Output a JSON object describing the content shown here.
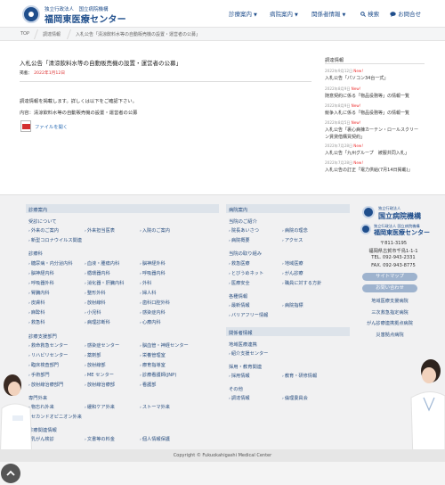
{
  "header": {
    "logo_sub": "独立行政法人　国立病院機構",
    "logo_title": "福岡東医療センター",
    "nav": {
      "item1": "診療案内",
      "item2": "病院案内",
      "item3": "関係者情報",
      "item4": "検索",
      "item5": "お問合せ"
    }
  },
  "breadcrumb": {
    "home": "TOP",
    "parent": "調達情報",
    "current": "入札公告「清涼飲料水等の自動販売機の設置・運営者の公募」"
  },
  "article": {
    "title": "入札公告「清涼飲料水等の自動販売機の設置・運営者の公募」",
    "date_label": "掲載：",
    "date_value": "2022年1月12日",
    "paragraph1": "調達情報を掲載します。詳しくは以下をご確認下さい。",
    "paragraph2": "内容：清涼飲料水等の自動販売機の設置・運営者の公募",
    "file_link": "ファイルを開く"
  },
  "sidebar": {
    "title": "調達情報",
    "new_badge": "New!",
    "entries": {
      "e1": {
        "date": "2022年9月12日",
        "text": "入札公告「パソコン34台一式」"
      },
      "e2": {
        "date": "2022年8月9日",
        "text": "随意契約に係る「物品役務等」の情報一覧"
      },
      "e3": {
        "date": "2022年8月9日",
        "text": "競争入札に係る「物品役務等」の情報一覧"
      },
      "e4": {
        "date": "2022年8月5日",
        "text1": "入札公告「裏心病棟カーテン・ロールスクリー",
        "text2": "ン賃貸借購買契約」"
      },
      "e5": {
        "date": "2022年7月28日",
        "text": "入札公告「九州グループ　被服共同入札」"
      },
      "e6": {
        "date": "2022年7月28日",
        "text": "入札公告の訂正「電力供給(7月14日掲載)」"
      }
    }
  },
  "footer": {
    "heads": {
      "shinryo": "診療案内",
      "byoin": "病院案内",
      "kankei": "関係者情報"
    },
    "sub": {
      "gairai_head": "受診について",
      "shinryoka_head": "診療科",
      "support_head": "診療支援部門",
      "senmon_head": "専門外来",
      "sonota_head": "診療関連情報",
      "intro_head": "当院のご紹介",
      "torikumi_head": "当院の取り組み",
      "kaku_head": "各種情報",
      "renkei_head": "地域医療連携",
      "saiyo_head": "採用・教育関連",
      "other_head": "その他"
    },
    "links": {
      "jushin": [
        "外来のご案内",
        "新型コロナウイルス関連",
        "外来担当医表",
        "入院のご案内"
      ],
      "shinryoka": [
        "糖尿病・内分泌内科",
        "脳神経内科",
        "呼吸器外科",
        "腎臓内科",
        "皮膚科",
        "麻酔科",
        "救急科",
        "血液・腫瘍内科",
        "循環器内科",
        "消化器・肝臓内科",
        "整形外科",
        "放射線科",
        "小児科",
        "病理診断科",
        "脳神経外科",
        "呼吸器内科",
        "外科",
        "婦人科",
        "歯科口腔外科",
        "感染症内科",
        "心療内科"
      ],
      "support": [
        "救命救急センター",
        "リハビリセンター",
        "臨床検査部門",
        "手術部門",
        "放射線治療部門",
        "感染症センター",
        "薬剤部",
        "放射線部",
        "ME センター",
        "放射線治療部",
        "脳血管・神経センター",
        "栄養管理室",
        "療育指導室",
        "診療看護師(JNP)",
        "看護部"
      ],
      "senmon": [
        "物忘れ外来",
        "セカンドオピニオン外来",
        "緩和ケア外来",
        "ストーマ外来"
      ],
      "sonota": [
        "乳がん検診",
        "文書等の料金",
        "個人情報保護"
      ],
      "intro": [
        "院長あいさつ",
        "病院概要",
        "病院の理念",
        "アクセス"
      ],
      "torikumi": [
        "救急医療",
        "とびうめネット",
        "医療安全",
        "地域医療",
        "がん診療",
        "職員に対する方針"
      ],
      "kaku": [
        "最新情報",
        "バリアフリー情報",
        "病院指標"
      ],
      "renkei": [
        "紹介支援センター"
      ],
      "saiyo": [
        "採用情報",
        "教育・研修情報"
      ],
      "other": [
        "調達情報",
        "倫理委員会"
      ]
    },
    "logo1_sub": "独立行政法人",
    "logo1_title": "国立病院機構",
    "logo2_sub": "独立行政法人 国立病院機構",
    "logo2_title": "福岡東医療センター",
    "postal": "〒811-3195",
    "address": "福岡県古賀市千鳥1-1-1",
    "tel": "TEL. 092-943-2331",
    "fax": "FAX. 092-943-8775",
    "btn_sitemap": "サイトマップ",
    "btn_contact": "お問い合わせ",
    "ext_links": [
      "地域医療支援病院",
      "三次救急指定病院",
      "がん診療連携拠点病院",
      "災害拠点病院"
    ],
    "copyright": "Copyright © Fukuokahigashi Medical Center"
  }
}
